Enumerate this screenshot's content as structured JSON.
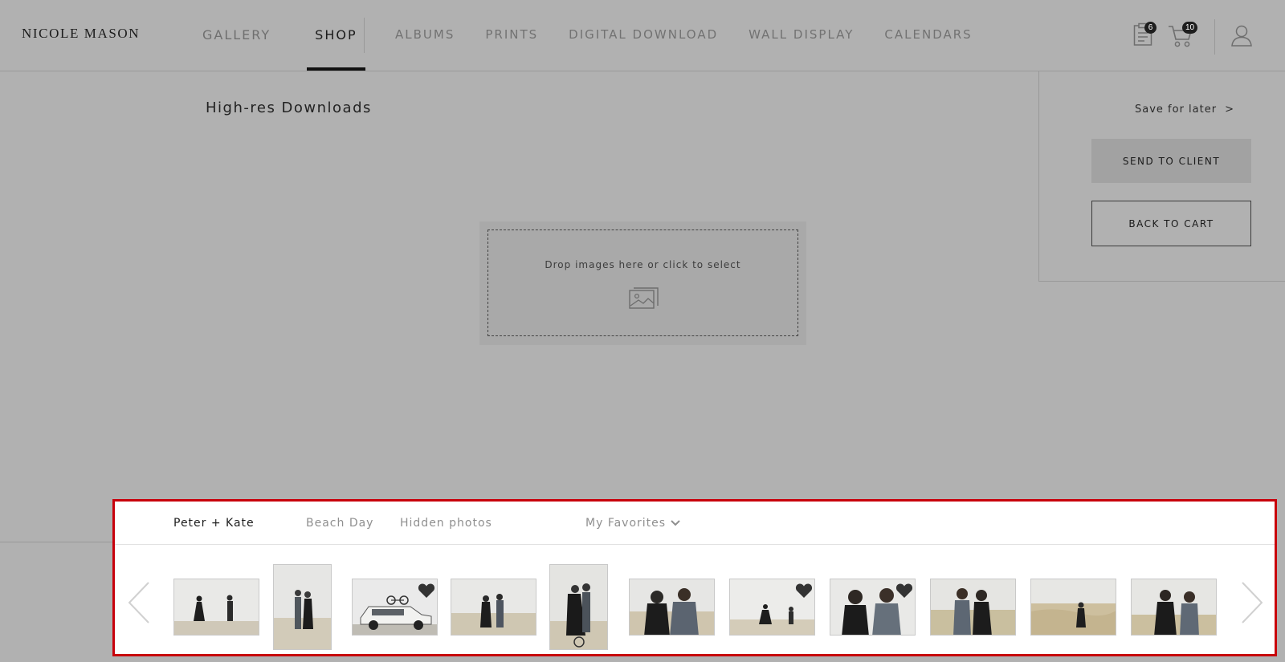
{
  "brand": {
    "logo": "NICOLE MASON"
  },
  "nav": {
    "main": [
      {
        "label": "GALLERY",
        "active": false
      },
      {
        "label": "SHOP",
        "active": true
      }
    ],
    "sub": [
      "ALBUMS",
      "PRINTS",
      "DIGITAL DOWNLOAD",
      "WALL DISPLAY",
      "CALENDARS"
    ]
  },
  "header_icons": {
    "orders_icon": "clipboard-icon",
    "orders_count": "6",
    "cart_icon": "cart-icon",
    "cart_count": "10",
    "account_icon": "user-icon"
  },
  "page": {
    "title": "High-res Downloads",
    "drop_zone": {
      "text": "Drop images here or click to select",
      "icon": "image-icon"
    }
  },
  "side_panel": {
    "save_later": "Save for later",
    "save_later_chevron": ">",
    "send_to_client": "SEND TO CLIENT",
    "back_to_cart": "BACK TO CART"
  },
  "strip": {
    "tabs": [
      {
        "label": "Peter + Kate",
        "active": true
      },
      {
        "label": "Beach Day",
        "active": false
      },
      {
        "label": "Hidden photos",
        "active": false
      }
    ],
    "favorites": {
      "label": "My Favorites",
      "icon": "chevron-down-icon"
    },
    "prev_icon": "chevron-left-icon",
    "next_icon": "chevron-right-icon",
    "thumbnails": [
      {
        "orientation": "landscape",
        "favorite": false
      },
      {
        "orientation": "portrait",
        "favorite": false
      },
      {
        "orientation": "landscape",
        "favorite": true
      },
      {
        "orientation": "landscape",
        "favorite": false
      },
      {
        "orientation": "portrait",
        "favorite": false
      },
      {
        "orientation": "landscape",
        "favorite": false
      },
      {
        "orientation": "landscape",
        "favorite": true
      },
      {
        "orientation": "landscape",
        "favorite": true
      },
      {
        "orientation": "landscape",
        "favorite": false
      },
      {
        "orientation": "landscape",
        "favorite": false
      },
      {
        "orientation": "landscape",
        "favorite": false
      }
    ]
  },
  "colors": {
    "overlay": "#b1b1b1",
    "highlight_border": "#c8000b",
    "badge": "#1e1e1e"
  }
}
